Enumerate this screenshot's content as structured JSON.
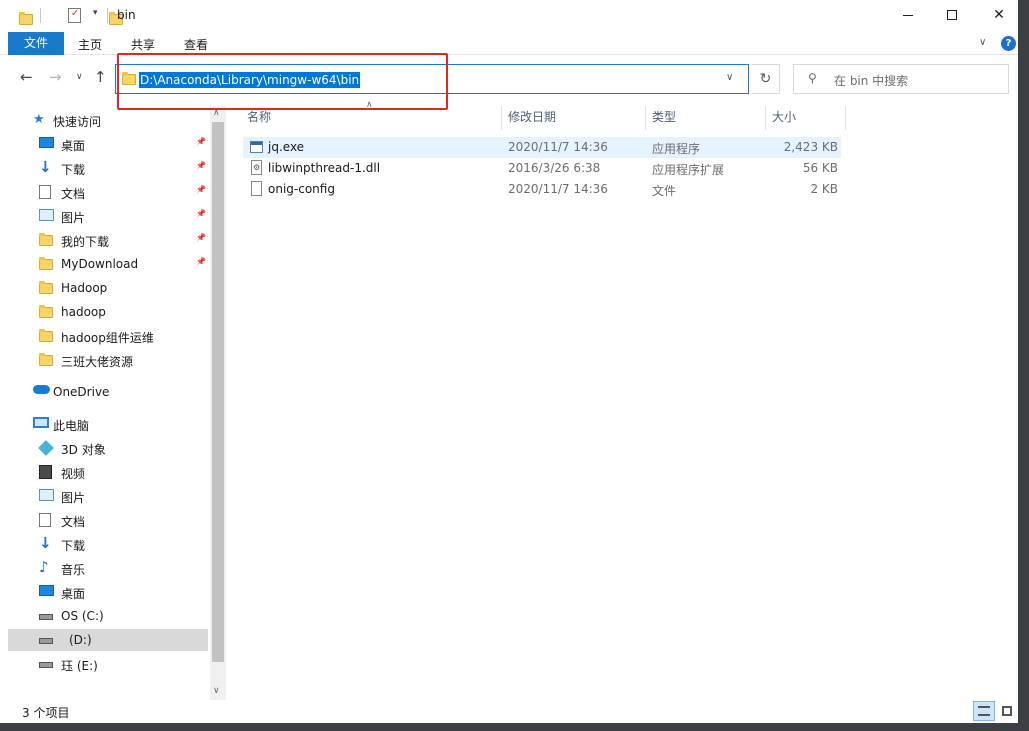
{
  "window": {
    "title": "bin"
  },
  "ribbon": {
    "tabs": [
      "文件",
      "主页",
      "共享",
      "查看"
    ]
  },
  "nav": {
    "address": "D:\\Anaconda\\Library\\mingw-w64\\bin",
    "search_placeholder": "在 bin 中搜索"
  },
  "sidebar": {
    "items": [
      {
        "label": "快速访问",
        "icon": "star-icon",
        "indent": 0,
        "pinned": false
      },
      {
        "label": "桌面",
        "icon": "desktop-icon",
        "indent": 1,
        "pinned": true
      },
      {
        "label": "下载",
        "icon": "download-icon",
        "indent": 1,
        "pinned": true
      },
      {
        "label": "文档",
        "icon": "document-icon",
        "indent": 1,
        "pinned": true
      },
      {
        "label": "图片",
        "icon": "pictures-icon",
        "indent": 1,
        "pinned": true
      },
      {
        "label": "我的下载",
        "icon": "folder-icon",
        "indent": 1,
        "pinned": true
      },
      {
        "label": "MyDownload",
        "icon": "folder-icon",
        "indent": 1,
        "pinned": true
      },
      {
        "label": "Hadoop",
        "icon": "folder-icon",
        "indent": 1,
        "pinned": false
      },
      {
        "label": "hadoop",
        "icon": "folder-icon",
        "indent": 1,
        "pinned": false
      },
      {
        "label": "hadoop组件运维",
        "icon": "folder-icon",
        "indent": 1,
        "pinned": false
      },
      {
        "label": "三班大佬资源",
        "icon": "folder-icon",
        "indent": 1,
        "pinned": false
      },
      {
        "label": "OneDrive",
        "icon": "onedrive-icon",
        "indent": 0,
        "pinned": false
      },
      {
        "label": "此电脑",
        "icon": "computer-icon",
        "indent": 0,
        "pinned": false
      },
      {
        "label": "3D 对象",
        "icon": "3d-objects-icon",
        "indent": 1,
        "pinned": false
      },
      {
        "label": "视频",
        "icon": "video-icon",
        "indent": 1,
        "pinned": false
      },
      {
        "label": "图片",
        "icon": "pictures-icon",
        "indent": 1,
        "pinned": false
      },
      {
        "label": "文档",
        "icon": "document-icon",
        "indent": 1,
        "pinned": false
      },
      {
        "label": "下载",
        "icon": "download-icon",
        "indent": 1,
        "pinned": false
      },
      {
        "label": "音乐",
        "icon": "music-icon",
        "indent": 1,
        "pinned": false
      },
      {
        "label": "桌面",
        "icon": "desktop-icon",
        "indent": 1,
        "pinned": false
      },
      {
        "label": "OS (C:)",
        "icon": "drive-icon",
        "indent": 1,
        "pinned": false
      },
      {
        "label": "(D:)",
        "icon": "drive-icon",
        "indent": 1,
        "pinned": false,
        "selected": true
      },
      {
        "label": "珏 (E:)",
        "icon": "drive-icon",
        "indent": 1,
        "pinned": false
      }
    ]
  },
  "filelist": {
    "columns": [
      "名称",
      "修改日期",
      "类型",
      "大小"
    ],
    "rows": [
      {
        "name": "jq.exe",
        "date": "2020/11/7 14:36",
        "type": "应用程序",
        "size": "2,423 KB",
        "icon": "exe-file-icon",
        "selected": true
      },
      {
        "name": "libwinpthread-1.dll",
        "date": "2016/3/26 6:38",
        "type": "应用程序扩展",
        "size": "56 KB",
        "icon": "dll-file-icon",
        "selected": false
      },
      {
        "name": "onig-config",
        "date": "2020/11/7 14:36",
        "type": "文件",
        "size": "2 KB",
        "icon": "file-icon",
        "selected": false
      }
    ]
  },
  "status": {
    "item_count": "3 个项目"
  },
  "colors": {
    "accent": "#1979ca",
    "selection": "#0078d7",
    "annotation": "#e0281f"
  }
}
